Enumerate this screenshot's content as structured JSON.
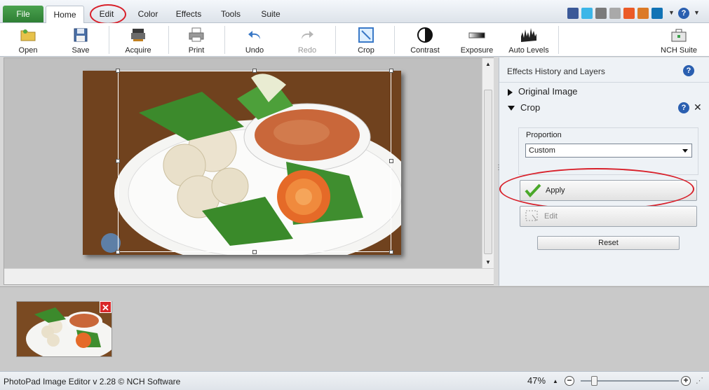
{
  "menu": {
    "tabs": [
      "File",
      "Home",
      "Edit",
      "Color",
      "Effects",
      "Tools",
      "Suite"
    ],
    "active": "Home",
    "social_icons": [
      "facebook-icon",
      "twitter-icon",
      "plus-icon",
      "delicious-icon",
      "stumbleupon-icon",
      "linkedin-icon"
    ],
    "help_glyph": "?"
  },
  "toolbar": {
    "buttons": [
      "Open",
      "Save",
      "Acquire",
      "Print",
      "Undo",
      "Redo",
      "Crop",
      "Contrast",
      "Exposure",
      "Auto Levels",
      "NCH Suite"
    ]
  },
  "panel": {
    "title": "Effects History and Layers",
    "layers": [
      "Original Image",
      "Crop"
    ],
    "proportion_label": "Proportion",
    "proportion_value": "Custom",
    "apply_label": "Apply",
    "edit_label": "Edit",
    "reset_label": "Reset",
    "help_glyph": "?",
    "close_glyph": "✕"
  },
  "thumb": {
    "close_glyph": "✕"
  },
  "status": {
    "text": "PhotoPad Image Editor v 2.28 © NCH Software",
    "zoom": "47%"
  },
  "colors": {
    "accent_red": "#d8202a",
    "file_tab": "#3a8e3f",
    "help_blue": "#2a5fb0"
  }
}
